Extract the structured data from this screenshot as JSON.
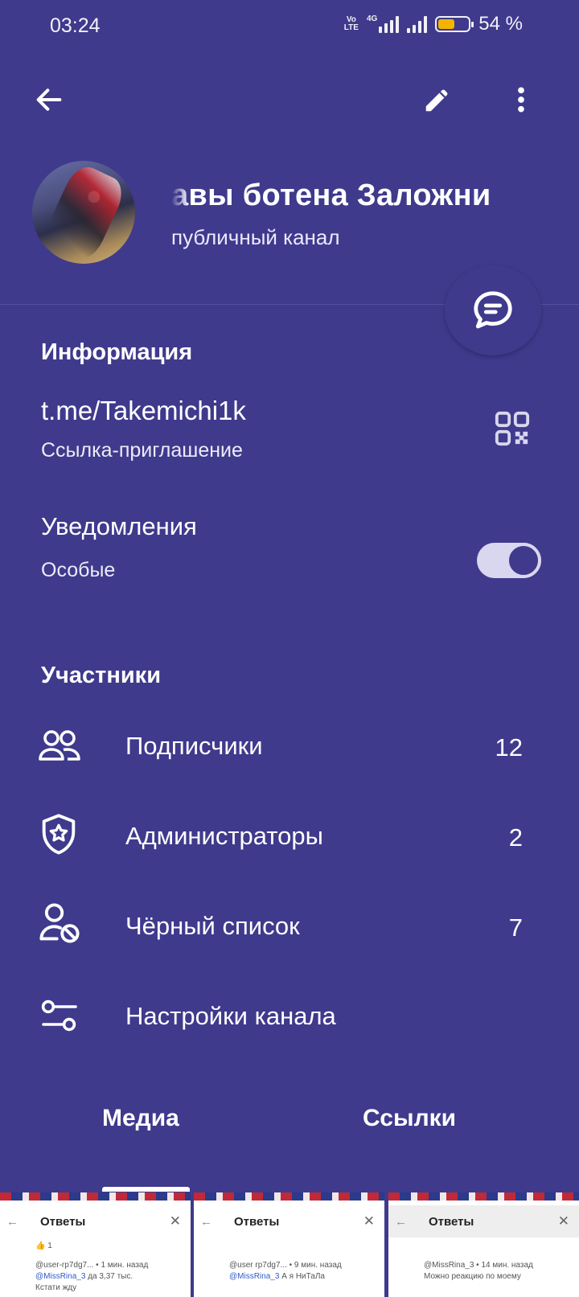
{
  "status_bar": {
    "time": "03:24",
    "volte": "Vo LTE",
    "network": "4G",
    "battery_percent": "54 %",
    "battery_level": 0.54,
    "battery_color": "#f5b400"
  },
  "toolbar": {
    "back_icon": "arrow-left-icon",
    "edit_icon": "pencil-icon",
    "more_icon": "more-vertical-icon"
  },
  "channel": {
    "title": "авы ботена   Заложни",
    "subtitle": "публичный канал"
  },
  "info": {
    "section_title": "Информация",
    "link": "t.me/Takemichi1k",
    "link_caption": "Ссылка-приглашение",
    "notifications_label": "Уведомления",
    "notifications_value": "Особые",
    "notifications_on": true
  },
  "members": {
    "section_title": "Участники",
    "rows": [
      {
        "label": "Подписчики",
        "count": "12",
        "icon": "users-icon"
      },
      {
        "label": "Администраторы",
        "count": "2",
        "icon": "shield-star-icon"
      },
      {
        "label": "Чёрный список",
        "count": "7",
        "icon": "user-blocked-icon"
      },
      {
        "label": "Настройки канала",
        "count": "",
        "icon": "sliders-icon"
      }
    ]
  },
  "tabs": [
    {
      "label": "Медиа",
      "active": true
    },
    {
      "label": "Ссылки",
      "active": false
    }
  ],
  "media": [
    {
      "title": "Ответы",
      "line1": "1",
      "line2": "@user-rp7dg7... • 1 мин. назад",
      "mention": "@MissRina_3",
      "line3": "да 3,37 тыс.",
      "line4": "Кстати жду"
    },
    {
      "title": "Ответы",
      "line1": "",
      "line2": "@user rp7dg7... • 9 мин. назад",
      "mention": "@MissRina_3",
      "line3": "А я НиТаЛа",
      "line4": ""
    },
    {
      "title": "Ответы",
      "line1": "",
      "line2": "@MissRina_3 • 14 мин. назад",
      "mention": "",
      "line3": "Можно реакцию по моему",
      "line4": ""
    }
  ],
  "colors": {
    "background": "#3f3a8c",
    "toggle_track": "#d9d6ef"
  }
}
